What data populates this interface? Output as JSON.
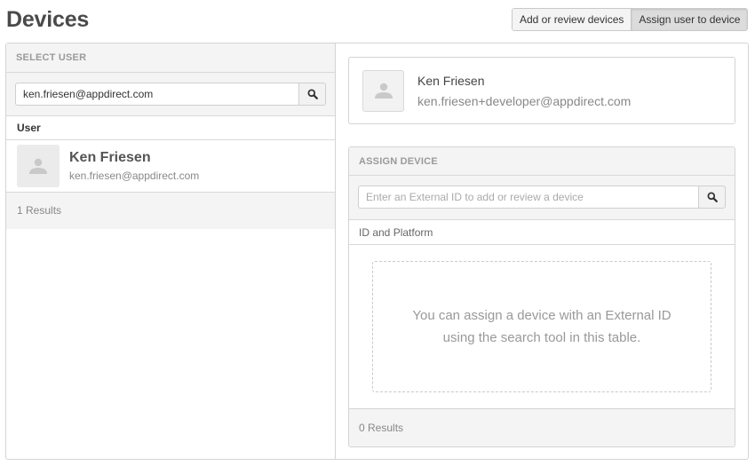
{
  "page": {
    "title": "Devices"
  },
  "mode_toggle": {
    "options": [
      {
        "label": "Add or review devices",
        "active": false
      },
      {
        "label": "Assign user to device",
        "active": true
      }
    ]
  },
  "select_user": {
    "heading": "SELECT USER",
    "search": {
      "value": "ken.friesen@appdirect.com",
      "placeholder": "",
      "icon": "search-icon"
    },
    "column_header": "User",
    "users": [
      {
        "name": "Ken Friesen",
        "email": "ken.friesen@appdirect.com",
        "avatar_icon": "user-silhouette-icon"
      }
    ],
    "results_text": "1 Results"
  },
  "selected_user": {
    "name": "Ken Friesen",
    "email": "ken.friesen+developer@appdirect.com",
    "avatar_icon": "user-silhouette-icon"
  },
  "assign_device": {
    "heading": "ASSIGN DEVICE",
    "search": {
      "value": "",
      "placeholder": "Enter an External ID to add or review a device",
      "icon": "search-icon"
    },
    "column_header": "ID and Platform",
    "empty_message": "You can assign a device with an External ID using the search tool in this table.",
    "results_text": "0 Results"
  }
}
